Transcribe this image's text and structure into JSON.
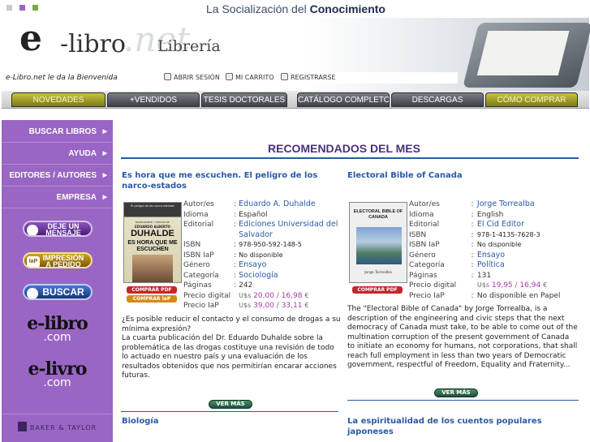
{
  "header": {
    "slogan_prefix": "La Socialización del ",
    "slogan_bold": "Conocimiento",
    "logo_e": "e",
    "logo_libro": "-libro",
    "logo_net": ".net",
    "logo_section": "Librería",
    "welcome": "e-Libro.net le da la Bienvenida",
    "toplinks": [
      "ABRIR SESIÓN",
      "MI CARRITO",
      "REGISTRARSE"
    ]
  },
  "nav": {
    "tabs": [
      "NOVEDADES",
      "+VENDIDOS",
      "TESIS DOCTORALES",
      "CATÁLOGO COMPLETO",
      "DESCARGAS",
      "CÓMO COMPRAR"
    ]
  },
  "sidebar": {
    "items": [
      "BUSCAR LIBROS",
      "AYUDA",
      "EDITORES / AUTORES",
      "EMPRESA"
    ],
    "pill_msg": [
      "DEJE UN",
      "MENSAJE"
    ],
    "pill_iap_badge": "IaP",
    "pill_iap": [
      "IMPRESIÓN",
      "A PEDIDO"
    ],
    "pill_buscar": "BUSCAR",
    "logo_elibro": [
      "e-libro",
      ".com"
    ],
    "logo_elivro": [
      "e-livro",
      ".com"
    ],
    "baker": "BAKER & TAYLOR"
  },
  "main": {
    "title": "RECOMENDADOS DEL MES",
    "labels": {
      "autor": "Autor/es",
      "idioma": "Idioma",
      "editorial": "Editorial",
      "isbn": "ISBN",
      "isbn_iap": "ISBN IaP",
      "genero": "Género",
      "categoria": "Categoría",
      "paginas": "Páginas",
      "precio_digital": "Precio digital",
      "precio_iap": "Precio IaP",
      "sep": ":",
      "usd": "U$s",
      "eur": "€",
      "slash": " / ",
      "comprar_pdf": "COMPRAR PDF",
      "comprar_iap": "COMPRAR IaP",
      "ver_mas": "VER MÁS"
    },
    "book1": {
      "title": "Es hora que me escuchen. El peligro de los narco-estados",
      "cover_top": "El peligro de los narco-estados",
      "cover_author_line1": "PARTICIPANTE Y GESTOR DE",
      "cover_author_line2": "EDUARDO ALBERTO",
      "cover_author_big": "DUHALDE",
      "cover_title": "ES HORA QUE ME ESCUCHEN",
      "author": "Eduardo A. Duhalde",
      "language": "Español",
      "publisher": "Ediciones Universidad del Salvador",
      "isbn": "978-950-592-148-5",
      "isbn_iap": "No disponible",
      "genre": "Ensayo",
      "category": "Sociología",
      "pages": "242",
      "price_digital_usd": "20,00",
      "price_digital_eur": "16,98",
      "price_iap_usd": "39,00",
      "price_iap_eur": "33,11",
      "description": "¿Es posible reducir el contacto y el consumo de drogas a su mínima expresión?\nLa cuarta publicación del Dr. Eduardo Duhalde sobre la problemática de las drogas costituye una revisión de todo lo actuado en nuestro país y una evaluación de los resultados obtenidos que nos permitirían encarar acciones futuras."
    },
    "book2": {
      "title": "Electoral Bible of Canada",
      "cover_title": "ELECTORAL BIBLE OF CANADA",
      "cover_author": "Jorge Torrealba",
      "author": "Jorge Torrealba",
      "language": "English",
      "publisher": "El Cid Editor",
      "isbn": "978-1-4135-7628-3",
      "isbn_iap": "No disponible",
      "genre": "Ensayo",
      "category": "Política",
      "pages": "131",
      "price_digital_usd": "19,95",
      "price_digital_eur": "16,94",
      "price_iap": "No disponible en Papel",
      "description": "The \"Electoral Bible of Canada\" by Jorge Torrealba, is a description of the engineering and civic steps that the next democracy of Canada must take, to be able to come out of the multination corruption of the present government of Canada to initiate an economy for humans, not corporations, that shall reach full employment in less than two years of Democratic government, respectful of Freedom, Equality and Fraternity..."
    },
    "book3": {
      "title": "Biología"
    },
    "book4": {
      "title": "La espiritualidad de los cuentos populares japoneses"
    }
  },
  "colors": {
    "sidebar": "#9a66c5",
    "heading": "#4c2f7c",
    "link": "#2a5aa7",
    "price": "#a23aa8",
    "gold_tab": "#a9a32a"
  }
}
